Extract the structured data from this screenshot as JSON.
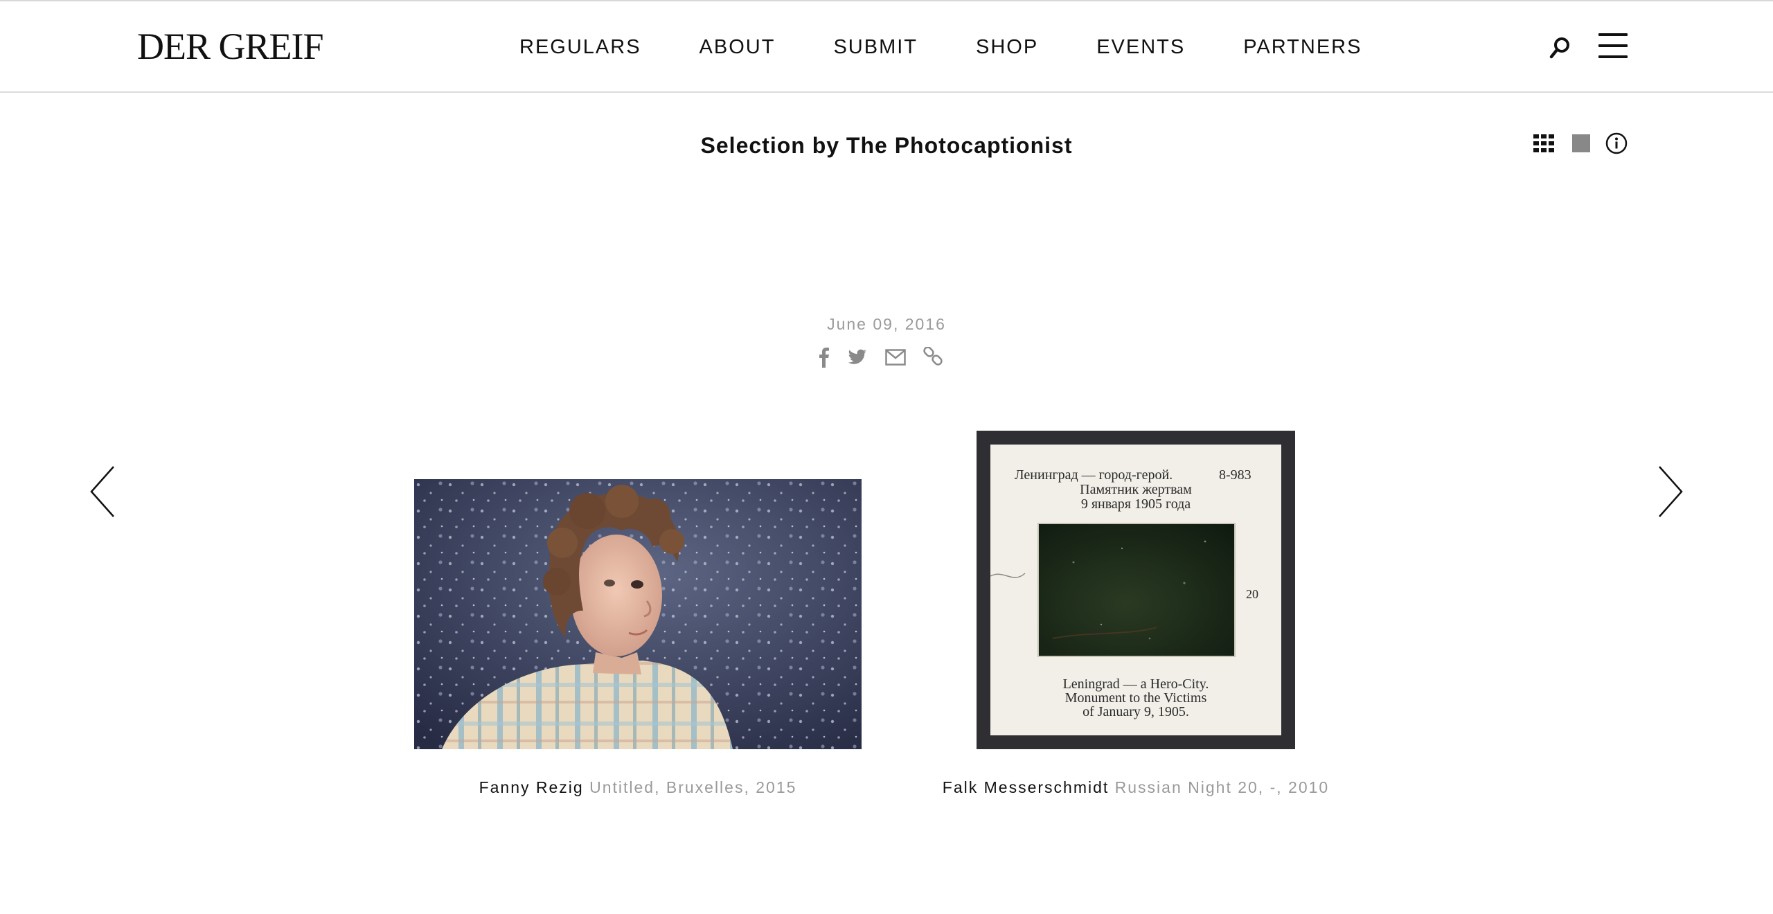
{
  "header": {
    "logo": "DER GREIF",
    "nav": [
      "REGULARS",
      "ABOUT",
      "SUBMIT",
      "SHOP",
      "EVENTS",
      "PARTNERS"
    ],
    "search_icon": "search-icon",
    "menu_icon": "hamburger-menu-icon"
  },
  "page": {
    "title": "Selection by The Photocaptionist",
    "view_tools": [
      "grid-view-icon",
      "single-view-icon",
      "info-icon"
    ],
    "date": "June 09, 2016",
    "share_icons": [
      "facebook-icon",
      "twitter-icon",
      "email-icon",
      "link-icon"
    ]
  },
  "gallery": {
    "prev_icon": "chevron-left-icon",
    "next_icon": "chevron-right-icon",
    "items": [
      {
        "artist": "Fanny Rezig",
        "work": "Untitled, Bruxelles, 2015"
      },
      {
        "artist": "Falk Messerschmidt",
        "work": "Russian Night 20, -, 2010",
        "slide_text": {
          "top_ru": [
            "Ленинград — город-герой.",
            "Памятник жертвам",
            "9 января 1905 года"
          ],
          "number": "8-983",
          "side_number": "20",
          "bottom_en": [
            "Leningrad — a Hero-City.",
            "Monument to the Victims",
            "of January 9, 1905."
          ]
        }
      }
    ]
  },
  "colors": {
    "text": "#111111",
    "muted": "#9a9a9a",
    "rule": "#dcdcdc",
    "slide_frame": "#2e2e33",
    "slide_card": "#f1efe8"
  }
}
